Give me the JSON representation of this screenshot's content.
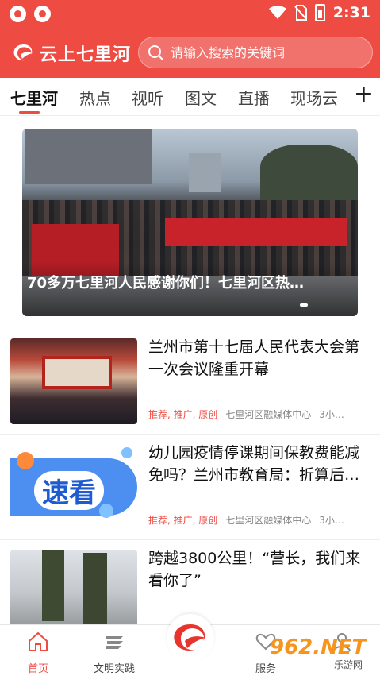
{
  "status_bar": {
    "time": "2:31"
  },
  "header": {
    "app_name": "云上七里河",
    "search_placeholder": "请输入搜索的关键词"
  },
  "tabs": [
    {
      "label": "七里河",
      "active": true
    },
    {
      "label": "热点"
    },
    {
      "label": "视听"
    },
    {
      "label": "图文"
    },
    {
      "label": "直播"
    },
    {
      "label": "现场云"
    }
  ],
  "tabs_more": "+",
  "banner": {
    "caption": "70多万七里河人民感谢你们！七里河区热…"
  },
  "news": [
    {
      "title": "兰州市第十七届人民代表大会第一次会议隆重开幕",
      "tags": "推荐, 推广, 原创",
      "source": "七里河区融媒体中心",
      "time": "3小…"
    },
    {
      "title": "幼儿园疫情停课期间保教费能减免吗？兰州市教育局：折算后…",
      "tags": "推荐, 推广, 原创",
      "source": "七里河区融媒体中心",
      "time": "3小…",
      "thumb_text": "速看"
    },
    {
      "title": "跨越3800公里！“营长，我们来看你了”",
      "tags": "",
      "source": "",
      "time": ""
    }
  ],
  "bottom_nav": [
    {
      "label": "首页",
      "icon": "home-icon",
      "active": true
    },
    {
      "label": "文明实践",
      "icon": "book-stack-icon"
    },
    {
      "label": "",
      "icon": "logo-center-icon"
    },
    {
      "label": "服务",
      "icon": "heart-hand-icon"
    },
    {
      "label": "",
      "icon": "user-icon"
    }
  ],
  "watermark": {
    "text": "962.NET",
    "sub": "乐游网"
  },
  "colors": {
    "brand": "#ee4b43"
  }
}
